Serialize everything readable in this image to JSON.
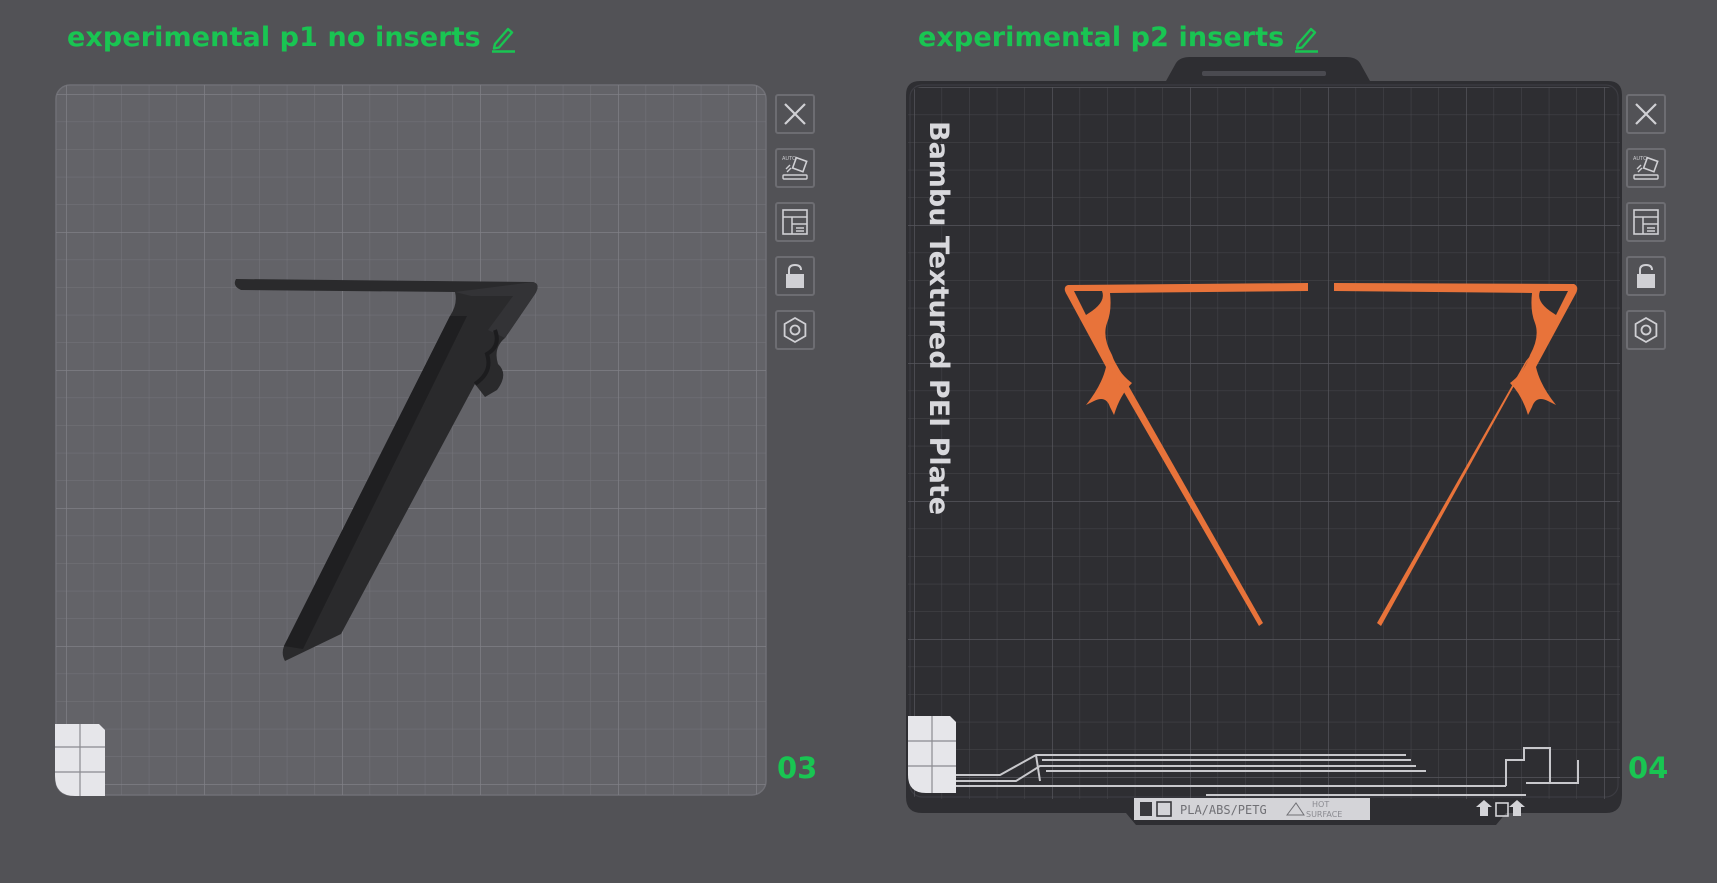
{
  "plates": [
    {
      "title": "experimental p1 no inserts",
      "number": "03"
    },
    {
      "title": "experimental p2 inserts",
      "number": "04",
      "plate_label": "Bambu Textured PEI Plate",
      "strip_text": "PLA/ABS/PETG",
      "strip_hot": "HOT",
      "strip_surface": "SURFACE"
    }
  ],
  "toolbar_icons": [
    "close-icon",
    "auto-orient-icon",
    "arrange-icon",
    "lock-icon",
    "settings-hex-icon"
  ],
  "colors": {
    "accent": "#19c552",
    "model_orange": "#e8733a",
    "model_dark": "#2a2a2c",
    "plate_light": "#636368",
    "plate_dark": "#2e2e32"
  }
}
